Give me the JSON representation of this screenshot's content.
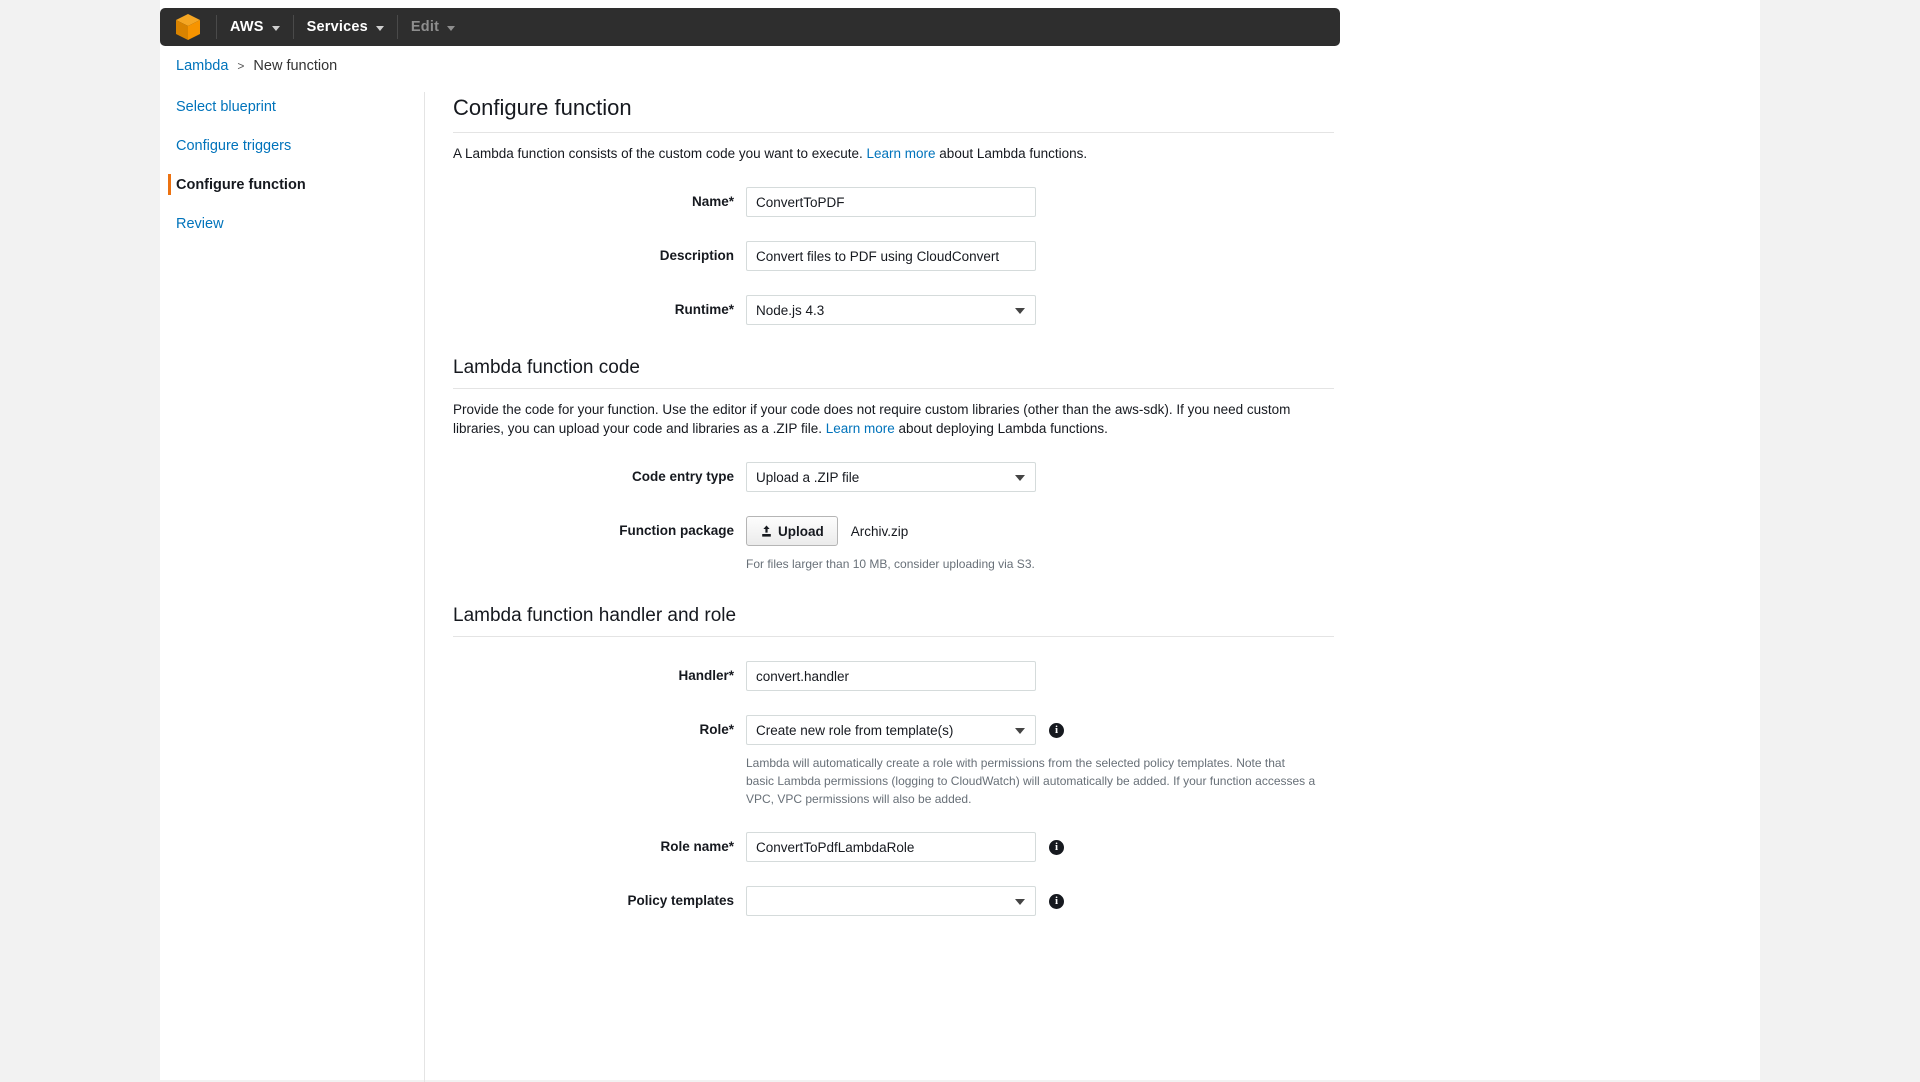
{
  "navbar": {
    "logo_icon": "aws-cube-icon",
    "items": [
      {
        "label": "AWS",
        "dimmed": false
      },
      {
        "label": "Services",
        "dimmed": false
      },
      {
        "label": "Edit",
        "dimmed": true
      }
    ]
  },
  "breadcrumb": {
    "root": "Lambda",
    "separator": ">",
    "current": "New function"
  },
  "sidebar": {
    "items": [
      {
        "label": "Select blueprint",
        "active": false
      },
      {
        "label": "Configure triggers",
        "active": false
      },
      {
        "label": "Configure function",
        "active": true
      },
      {
        "label": "Review",
        "active": false
      }
    ]
  },
  "main": {
    "title": "Configure function",
    "intro_before": "A Lambda function consists of the custom code you want to execute. ",
    "intro_link": "Learn more",
    "intro_after": " about Lambda functions.",
    "fields": {
      "name": {
        "label": "Name*",
        "value": "ConvertToPDF",
        "placeholder": ""
      },
      "description": {
        "label": "Description",
        "value": "Convert files to PDF using CloudConvert",
        "placeholder": ""
      },
      "runtime": {
        "label": "Runtime*",
        "value": "Node.js 4.3"
      }
    },
    "code_section": {
      "title": "Lambda function code",
      "intro_before": "Provide the code for your function. Use the editor if your code does not require custom libraries (other than the aws-sdk). If you need custom libraries, you can upload your code and libraries as a .ZIP file. ",
      "intro_link": "Learn more",
      "intro_after": " about deploying Lambda functions.",
      "code_entry_type": {
        "label": "Code entry type",
        "value": "Upload a .ZIP file"
      },
      "function_package": {
        "label": "Function package",
        "upload_button": "Upload",
        "upload_icon": "upload-icon",
        "file_name": "Archiv.zip",
        "hint": "For files larger than 10 MB, consider uploading via S3."
      }
    },
    "handler_section": {
      "title": "Lambda function handler and role",
      "handler": {
        "label": "Handler*",
        "value": "convert.handler"
      },
      "role": {
        "label": "Role*",
        "value": "Create new role from template(s)",
        "info_icon": "info-icon",
        "hint": "Lambda will automatically create a role with permissions from the selected policy templates. Note that basic Lambda permissions (logging to CloudWatch) will automatically be added. If your function accesses a VPC, VPC permissions will also be added."
      },
      "role_name": {
        "label": "Role name*",
        "value": "ConvertToPdfLambdaRole",
        "info_icon": "info-icon"
      },
      "policy_templates": {
        "label": "Policy templates",
        "value": "",
        "info_icon": "info-icon"
      }
    }
  },
  "colors": {
    "accent": "#ec7211",
    "link": "#0073bb",
    "navbar_bg": "#2e2e2e",
    "page_bg": "#f2f2f2"
  }
}
